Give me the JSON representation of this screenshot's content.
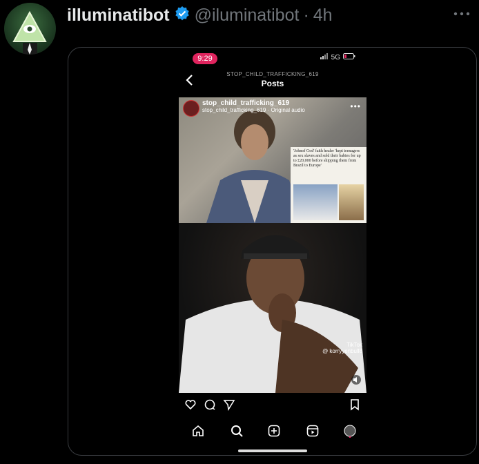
{
  "tweet": {
    "author_name": "illuminatibot",
    "author_handle": "@iluminatibot",
    "separator": "·",
    "time": "4h",
    "verified": true
  },
  "phone": {
    "status_time": "9:29",
    "network": "5G",
    "account_title": "STOP_CHILD_TRAFFICKING_619",
    "page_title": "Posts",
    "video": {
      "overlay_username": "stop_child_trafficking_619",
      "overlay_audio": "stop_child_trafficking_619 · Original audio",
      "news_headline": "'Johnof God' faith healer 'kept teenagers as sex slaves and sold their babies for up to £20,000 before shipping them from Brazil to Europe'",
      "tiktok_brand": "TikTok",
      "tiktok_user": "@ korryyenbull8"
    }
  },
  "icons": [
    "verified-icon",
    "more-icon",
    "back-icon",
    "heart-icon",
    "comment-icon",
    "share-icon",
    "bookmark-icon",
    "home-icon",
    "search-icon",
    "add-icon",
    "reels-icon",
    "profile-icon"
  ],
  "colors": {
    "verified": "#1d9bf0",
    "status_time_bg": "#e0245e",
    "handle": "#71767b"
  }
}
